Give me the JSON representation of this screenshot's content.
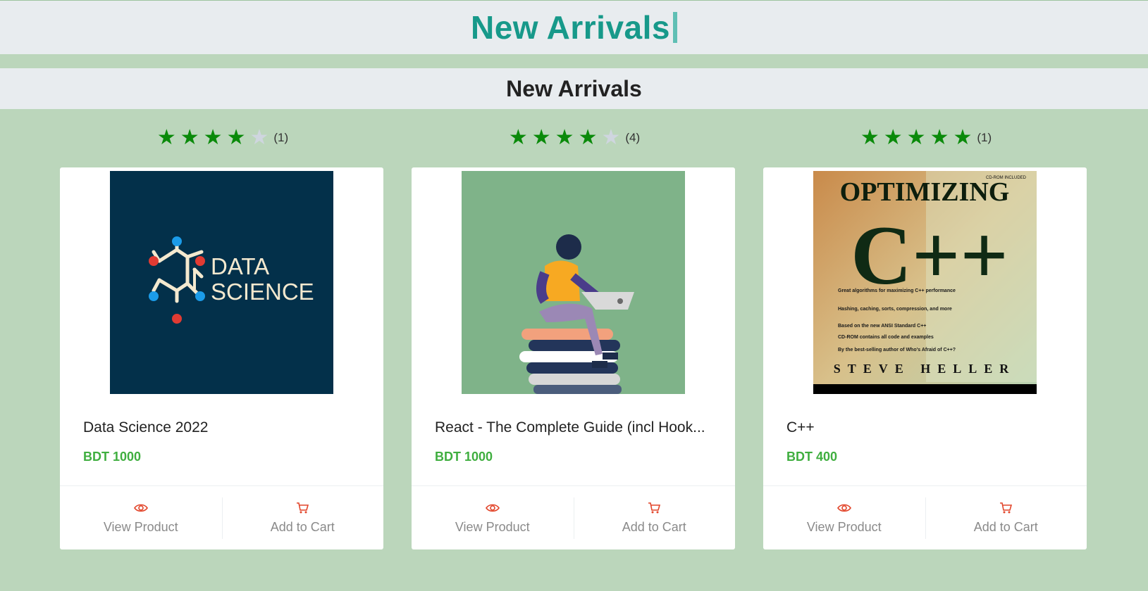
{
  "banner": {
    "title": "New Arrivals"
  },
  "section": {
    "title": "New Arrivals"
  },
  "colors": {
    "accent": "#17998a",
    "price": "#3fae3f",
    "star": "#0a8a0a",
    "icon": "#e2452a",
    "background": "#bbd6bb"
  },
  "products": [
    {
      "rating": 4,
      "max_rating": 5,
      "review_count": "(1)",
      "title": "Data Science 2022",
      "price": "BDT 1000",
      "image_text": [
        "DATA",
        "SCIENCE"
      ],
      "view_label": "View Product",
      "cart_label": "Add to Cart",
      "view_icon": "eye-icon",
      "cart_icon": "cart-icon"
    },
    {
      "rating": 4,
      "max_rating": 5,
      "review_count": "(4)",
      "title": "React - The Complete Guide (incl Hook...",
      "price": "BDT 1000",
      "view_label": "View Product",
      "cart_label": "Add to Cart",
      "view_icon": "eye-icon",
      "cart_icon": "cart-icon"
    },
    {
      "rating": 5,
      "max_rating": 5,
      "review_count": "(1)",
      "title": "C++",
      "price": "BDT 400",
      "image_text": [
        "CD-ROM INCLUDED",
        "OPTIMIZING",
        "C++",
        "Great algorithms for maximizing C++ performance",
        "Hashing, caching, sorts, compression, and more",
        "Based on the new ANSI Standard C++",
        "CD-ROM contains all code and examples",
        "By the best-selling author of Who's Afraid of C++?",
        "STEVE HELLER"
      ],
      "view_label": "View Product",
      "cart_label": "Add to Cart",
      "view_icon": "eye-icon",
      "cart_icon": "cart-icon"
    }
  ]
}
